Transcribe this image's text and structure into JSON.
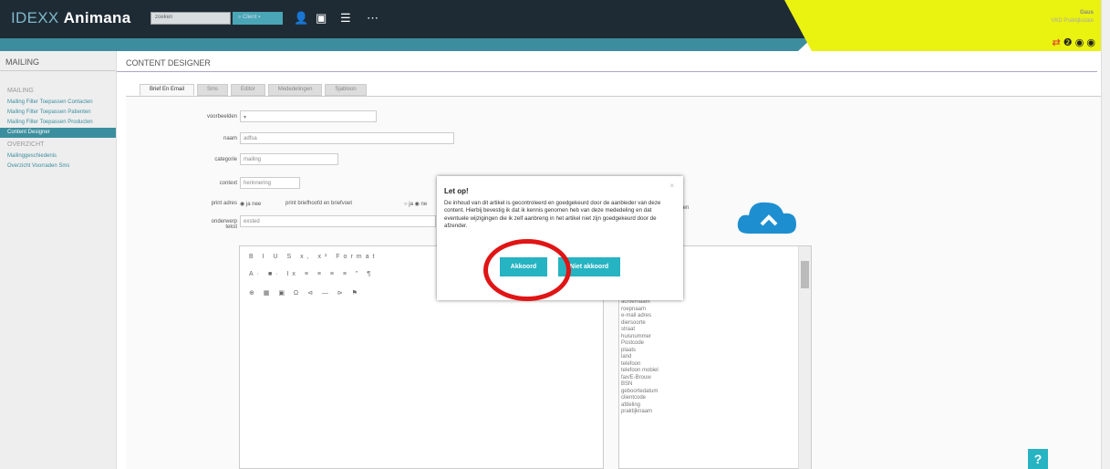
{
  "header": {
    "logo_prefix": "IDEXX",
    "logo_name": "Animana",
    "search_placeholder": "zoeken",
    "client_button": "Client",
    "user_name": "Gaus",
    "user_org": "VKD Praktijkstate"
  },
  "sidebar": {
    "header": "MAILING",
    "items": [
      {
        "label": "MAILING",
        "type": "section"
      },
      {
        "label": "Mailing Filter Toepassen Contacten",
        "type": "link"
      },
      {
        "label": "Mailing Filter Toepassen Patienten",
        "type": "link"
      },
      {
        "label": "Mailing Filter Toepassen Producten",
        "type": "link"
      },
      {
        "label": "Content Designer",
        "type": "active"
      },
      {
        "label": "OVERZICHT",
        "type": "section"
      },
      {
        "label": "Mailinggeschiedenis",
        "type": "link"
      },
      {
        "label": "Overzicht Voorraden Sms",
        "type": "link"
      }
    ]
  },
  "main": {
    "title": "CONTENT DESIGNER",
    "tabs": [
      "Brief En Email",
      "Sms",
      "Editor",
      "Mededelingen",
      "Sjabloon"
    ],
    "form": {
      "voorbeelden_label": "voorbeelden",
      "naam_label": "naam",
      "naam_value": "adfsa",
      "categorie_label": "categorie",
      "categorie_value": "mailing",
      "context_label": "context",
      "context_value": "herinnering",
      "print_adres_label": "print adres",
      "print_opts": "ja nee",
      "briefhoofd_label": "print briefhoofd en briefvoet",
      "onderwerp_label": "onderwerp",
      "onderwerp_value": "exsted",
      "tekst_label": "tekst",
      "fill_note": "te vullen"
    },
    "toolbar": {
      "row1": "B I U S x, x² Format",
      "row2": "A· ■· Ix ≡ ≡ ≡ ≡ \" ¶",
      "row3": "⊕ ▦ ▣ Ω ⊲ — ⊳ ⚑"
    },
    "variables": [
      "achternaam",
      "roepnaam",
      "e-mail adres",
      "diersoorte",
      "straat",
      "huisnummer",
      "Postcode",
      "plaats",
      "land",
      "telefoon",
      "telefoon mobiel",
      "fax/E-Brouw",
      "BSN",
      "geboortedatum",
      "clientcode",
      "afdeling",
      "praktijknaam"
    ]
  },
  "dialog": {
    "title": "Let op!",
    "close": "×",
    "message": "De inhoud van dit artikel is gecontroleerd en goedgekeurd door de aanbieder van deze content. Hierbij bevestig ik dat ik kennis genomen heb van deze mededeling en dat eventuele wijzigingen die ik zelf aanbreng in het artikel niet zijn goedgekeurd door de afzender.",
    "accept_label": "Akkoord",
    "reject_label": "Niet akkoord"
  },
  "help_label": "?",
  "colors": {
    "accent": "#26b3c2",
    "topbar": "#1e2b35",
    "yellow": "#eaf20f",
    "highlight": "#e01515"
  }
}
